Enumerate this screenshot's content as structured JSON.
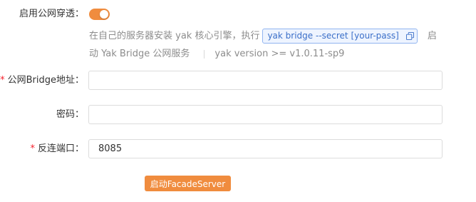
{
  "form": {
    "public_tunnel": {
      "label": "启用公网穿透：",
      "enabled": true,
      "help_prefix": "在自己的服务器安装 yak 核心引擎，执行",
      "command": "yak bridge --secret [your-pass]",
      "help_suffix": "启",
      "help_line2": "动 Yak Bridge 公网服务",
      "version_note": "yak version >= v1.0.11-sp9"
    },
    "bridge_address": {
      "required_mark": "*",
      "label": "公网Bridge地址：",
      "value": ""
    },
    "password": {
      "label": "密码：",
      "value": ""
    },
    "reverse_port": {
      "required_mark": "*",
      "label": "反连端口：",
      "value": "8085"
    },
    "submit_label": "启动FacadeServer"
  },
  "colors": {
    "accent": "#f08c3e",
    "required": "#f5222d",
    "code_text": "#3b6fc8"
  }
}
